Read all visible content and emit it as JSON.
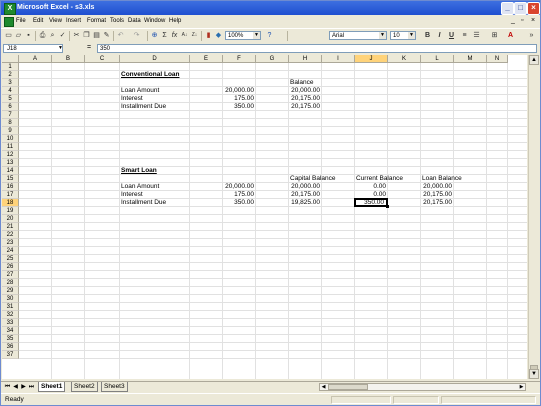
{
  "window": {
    "title": "Microsoft Excel - s3.xls",
    "app_icon": "excel-icon",
    "buttons": [
      "minimize",
      "maximize",
      "close"
    ]
  },
  "menu": {
    "items": [
      "File",
      "Edit",
      "View",
      "Insert",
      "Format",
      "Tools",
      "Data",
      "Window",
      "Help"
    ]
  },
  "toolbar": {
    "zoom": "100%",
    "font": "Arial",
    "font_size": "10",
    "bold": "B",
    "italic": "I",
    "underline": "U",
    "sigma": "Σ",
    "fx": "fx",
    "sort_asc": "A↓",
    "sort_desc": "Z↓",
    "font_color": "A"
  },
  "formula_bar": {
    "name_box": "J18",
    "equals": "=",
    "value": "350"
  },
  "columns": [
    "A",
    "B",
    "C",
    "D",
    "E",
    "F",
    "G",
    "H",
    "I",
    "J",
    "K",
    "L",
    "M",
    "N"
  ],
  "rows": [
    "1",
    "2",
    "3",
    "4",
    "5",
    "6",
    "7",
    "8",
    "9",
    "10",
    "11",
    "12",
    "13",
    "14",
    "15",
    "16",
    "17",
    "18",
    "19",
    "20",
    "21",
    "22",
    "23",
    "24",
    "25",
    "26",
    "27",
    "28",
    "29",
    "30",
    "31",
    "32",
    "33",
    "34",
    "35",
    "36",
    "37"
  ],
  "selected": {
    "column": "J",
    "row": "18"
  },
  "cells": {
    "D2": "Conventional Loan",
    "H3": "Balance",
    "D4": "Loan Amount",
    "F4": "20,000.00",
    "H4": "20,000.00",
    "D5": "Interest",
    "F5": "175.00",
    "H5": "20,175.00",
    "D6": "Installment Due",
    "F6": "350.00",
    "H6": "20,175.00",
    "D14": "Smart Loan",
    "H15": "Capital Balance",
    "J15": "Current Balance",
    "L15": "Loan Balance",
    "D16": "Loan Amount",
    "F16": "20,000.00",
    "H16": "20,000.00",
    "J16": "0.00",
    "L16": "20,000.00",
    "D17": "Interest",
    "F17": "175.00",
    "H17": "20,175.00",
    "J17": "0.00",
    "L17": "20,175.00",
    "D18": "Installment Due",
    "F18": "350.00",
    "H18": "19,825.00",
    "J18": "350.00",
    "L18": "20,175.00"
  },
  "sheets": [
    {
      "name": "Sheet1",
      "active": true
    },
    {
      "name": "Sheet2",
      "active": false
    },
    {
      "name": "Sheet3",
      "active": false
    }
  ],
  "status": {
    "text": "Ready"
  }
}
